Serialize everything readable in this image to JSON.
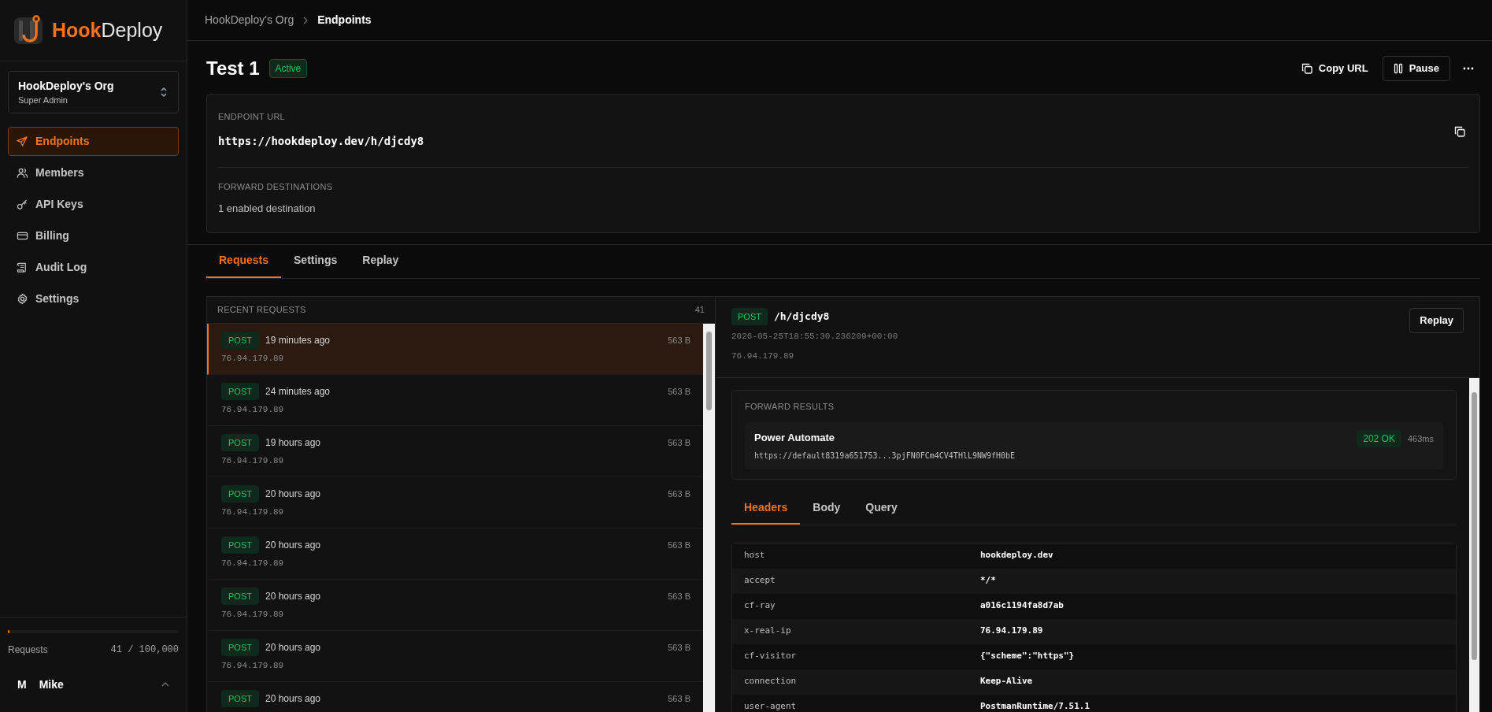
{
  "brand": {
    "accent": "Hook",
    "rest": "Deploy"
  },
  "org_switcher": {
    "name": "HookDeploy's Org",
    "role": "Super Admin"
  },
  "sidebar": {
    "items": [
      {
        "label": "Endpoints",
        "kind": "send",
        "selected": true
      },
      {
        "label": "Members",
        "kind": "users",
        "selected": false
      },
      {
        "label": "API Keys",
        "kind": "key",
        "selected": false
      },
      {
        "label": "Billing",
        "kind": "card",
        "selected": false
      },
      {
        "label": "Audit Log",
        "kind": "scroll",
        "selected": false
      },
      {
        "label": "Settings",
        "kind": "gear",
        "selected": false
      }
    ]
  },
  "usage": {
    "label": "Requests",
    "count": "41 / 100,000",
    "level": 0.0004
  },
  "user": {
    "initial": "M",
    "name": "Mike"
  },
  "breadcrumb": [
    {
      "label": "HookDeploy's Org",
      "current": false
    },
    {
      "label": "Endpoints",
      "current": true
    }
  ],
  "endpoint": {
    "title": "Test 1",
    "status": "Active",
    "actions": [
      {
        "label": "Copy URL",
        "kind": "copy"
      },
      {
        "label": "Pause",
        "kind": "pause"
      }
    ]
  },
  "url_card": {
    "url_label": "ENDPOINT URL",
    "url": "https://hookdeploy.dev/h/djcdy8",
    "forward_label": "FORWARD DESTINATIONS",
    "forward_text": "1 enabled destination"
  },
  "tabs": [
    {
      "label": "Requests",
      "selected": true
    },
    {
      "label": "Settings",
      "selected": false
    },
    {
      "label": "Replay",
      "selected": false
    }
  ],
  "requests": {
    "title": "RECENT REQUESTS",
    "count": "41",
    "rows": [
      {
        "method": "POST",
        "time": "19 minutes ago",
        "size": "563 B",
        "ip": "76.94.179.89",
        "selected": true
      },
      {
        "method": "POST",
        "time": "24 minutes ago",
        "size": "563 B",
        "ip": "76.94.179.89",
        "selected": false
      },
      {
        "method": "POST",
        "time": "19 hours ago",
        "size": "563 B",
        "ip": "76.94.179.89",
        "selected": false
      },
      {
        "method": "POST",
        "time": "20 hours ago",
        "size": "563 B",
        "ip": "76.94.179.89",
        "selected": false
      },
      {
        "method": "POST",
        "time": "20 hours ago",
        "size": "563 B",
        "ip": "76.94.179.89",
        "selected": false
      },
      {
        "method": "POST",
        "time": "20 hours ago",
        "size": "563 B",
        "ip": "76.94.179.89",
        "selected": false
      },
      {
        "method": "POST",
        "time": "20 hours ago",
        "size": "563 B",
        "ip": "76.94.179.89",
        "selected": false
      },
      {
        "method": "POST",
        "time": "20 hours ago",
        "size": "563 B",
        "selected": false
      }
    ]
  },
  "detail": {
    "method": "POST",
    "path": "/h/djcdy8",
    "timestamp": "2026-05-25T18:55:30.236209+00:00",
    "ip": "76.94.179.89",
    "replay": "Replay",
    "forward_results": {
      "title": "FORWARD RESULTS",
      "items": [
        {
          "name": "Power Automate",
          "url": "https://default8319a651753...3pjFN0FCm4CV4THlL9NW9fH0bE",
          "status": "202 OK",
          "duration": "463ms"
        }
      ]
    },
    "tabs": [
      {
        "label": "Headers",
        "selected": true
      },
      {
        "label": "Body",
        "selected": false
      },
      {
        "label": "Query",
        "selected": false
      }
    ],
    "headers": [
      {
        "name": "host",
        "value": "hookdeploy.dev"
      },
      {
        "name": "accept",
        "value": "*/*"
      },
      {
        "name": "cf-ray",
        "value": "a016c1194fa8d7ab"
      },
      {
        "name": "x-real-ip",
        "value": "76.94.179.89"
      },
      {
        "name": "cf-visitor",
        "value": "{\"scheme\":\"https\"}"
      },
      {
        "name": "connection",
        "value": "Keep-Alive"
      },
      {
        "name": "user-agent",
        "value": "PostmanRuntime/7.51.1"
      }
    ]
  }
}
